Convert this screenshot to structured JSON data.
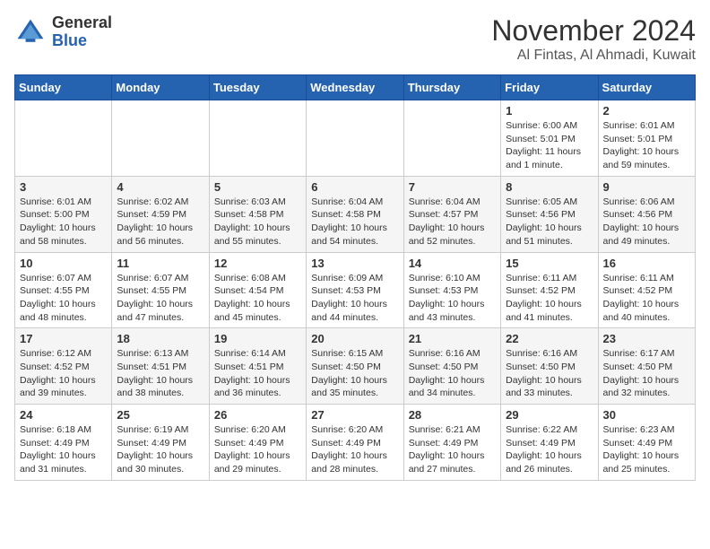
{
  "logo": {
    "general": "General",
    "blue": "Blue"
  },
  "title": {
    "month_year": "November 2024",
    "location": "Al Fintas, Al Ahmadi, Kuwait"
  },
  "weekdays": [
    "Sunday",
    "Monday",
    "Tuesday",
    "Wednesday",
    "Thursday",
    "Friday",
    "Saturday"
  ],
  "weeks": [
    [
      {
        "day": "",
        "info": ""
      },
      {
        "day": "",
        "info": ""
      },
      {
        "day": "",
        "info": ""
      },
      {
        "day": "",
        "info": ""
      },
      {
        "day": "",
        "info": ""
      },
      {
        "day": "1",
        "info": "Sunrise: 6:00 AM\nSunset: 5:01 PM\nDaylight: 11 hours\nand 1 minute."
      },
      {
        "day": "2",
        "info": "Sunrise: 6:01 AM\nSunset: 5:01 PM\nDaylight: 10 hours\nand 59 minutes."
      }
    ],
    [
      {
        "day": "3",
        "info": "Sunrise: 6:01 AM\nSunset: 5:00 PM\nDaylight: 10 hours\nand 58 minutes."
      },
      {
        "day": "4",
        "info": "Sunrise: 6:02 AM\nSunset: 4:59 PM\nDaylight: 10 hours\nand 56 minutes."
      },
      {
        "day": "5",
        "info": "Sunrise: 6:03 AM\nSunset: 4:58 PM\nDaylight: 10 hours\nand 55 minutes."
      },
      {
        "day": "6",
        "info": "Sunrise: 6:04 AM\nSunset: 4:58 PM\nDaylight: 10 hours\nand 54 minutes."
      },
      {
        "day": "7",
        "info": "Sunrise: 6:04 AM\nSunset: 4:57 PM\nDaylight: 10 hours\nand 52 minutes."
      },
      {
        "day": "8",
        "info": "Sunrise: 6:05 AM\nSunset: 4:56 PM\nDaylight: 10 hours\nand 51 minutes."
      },
      {
        "day": "9",
        "info": "Sunrise: 6:06 AM\nSunset: 4:56 PM\nDaylight: 10 hours\nand 49 minutes."
      }
    ],
    [
      {
        "day": "10",
        "info": "Sunrise: 6:07 AM\nSunset: 4:55 PM\nDaylight: 10 hours\nand 48 minutes."
      },
      {
        "day": "11",
        "info": "Sunrise: 6:07 AM\nSunset: 4:55 PM\nDaylight: 10 hours\nand 47 minutes."
      },
      {
        "day": "12",
        "info": "Sunrise: 6:08 AM\nSunset: 4:54 PM\nDaylight: 10 hours\nand 45 minutes."
      },
      {
        "day": "13",
        "info": "Sunrise: 6:09 AM\nSunset: 4:53 PM\nDaylight: 10 hours\nand 44 minutes."
      },
      {
        "day": "14",
        "info": "Sunrise: 6:10 AM\nSunset: 4:53 PM\nDaylight: 10 hours\nand 43 minutes."
      },
      {
        "day": "15",
        "info": "Sunrise: 6:11 AM\nSunset: 4:52 PM\nDaylight: 10 hours\nand 41 minutes."
      },
      {
        "day": "16",
        "info": "Sunrise: 6:11 AM\nSunset: 4:52 PM\nDaylight: 10 hours\nand 40 minutes."
      }
    ],
    [
      {
        "day": "17",
        "info": "Sunrise: 6:12 AM\nSunset: 4:52 PM\nDaylight: 10 hours\nand 39 minutes."
      },
      {
        "day": "18",
        "info": "Sunrise: 6:13 AM\nSunset: 4:51 PM\nDaylight: 10 hours\nand 38 minutes."
      },
      {
        "day": "19",
        "info": "Sunrise: 6:14 AM\nSunset: 4:51 PM\nDaylight: 10 hours\nand 36 minutes."
      },
      {
        "day": "20",
        "info": "Sunrise: 6:15 AM\nSunset: 4:50 PM\nDaylight: 10 hours\nand 35 minutes."
      },
      {
        "day": "21",
        "info": "Sunrise: 6:16 AM\nSunset: 4:50 PM\nDaylight: 10 hours\nand 34 minutes."
      },
      {
        "day": "22",
        "info": "Sunrise: 6:16 AM\nSunset: 4:50 PM\nDaylight: 10 hours\nand 33 minutes."
      },
      {
        "day": "23",
        "info": "Sunrise: 6:17 AM\nSunset: 4:50 PM\nDaylight: 10 hours\nand 32 minutes."
      }
    ],
    [
      {
        "day": "24",
        "info": "Sunrise: 6:18 AM\nSunset: 4:49 PM\nDaylight: 10 hours\nand 31 minutes."
      },
      {
        "day": "25",
        "info": "Sunrise: 6:19 AM\nSunset: 4:49 PM\nDaylight: 10 hours\nand 30 minutes."
      },
      {
        "day": "26",
        "info": "Sunrise: 6:20 AM\nSunset: 4:49 PM\nDaylight: 10 hours\nand 29 minutes."
      },
      {
        "day": "27",
        "info": "Sunrise: 6:20 AM\nSunset: 4:49 PM\nDaylight: 10 hours\nand 28 minutes."
      },
      {
        "day": "28",
        "info": "Sunrise: 6:21 AM\nSunset: 4:49 PM\nDaylight: 10 hours\nand 27 minutes."
      },
      {
        "day": "29",
        "info": "Sunrise: 6:22 AM\nSunset: 4:49 PM\nDaylight: 10 hours\nand 26 minutes."
      },
      {
        "day": "30",
        "info": "Sunrise: 6:23 AM\nSunset: 4:49 PM\nDaylight: 10 hours\nand 25 minutes."
      }
    ]
  ]
}
